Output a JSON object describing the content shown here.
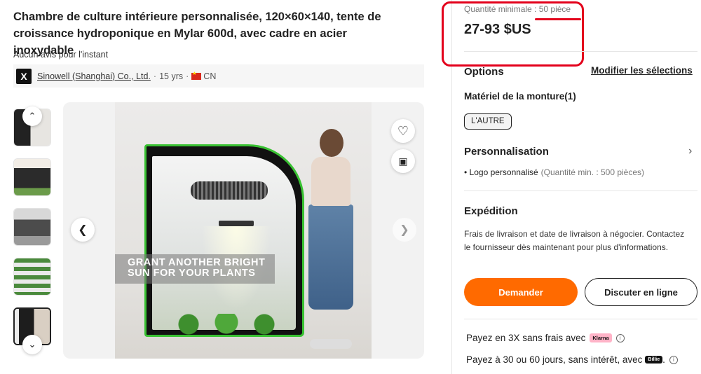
{
  "product": {
    "title": "Chambre de culture intérieure personnalisée, 120×60×140, tente de croissance hydroponique en Mylar 600d, avec cadre en acier inoxydable",
    "reviews": "Aucun avis pour l'instant"
  },
  "supplier": {
    "logo_letter": "X",
    "name": "Sinowell (Shanghai) Co., Ltd.",
    "years": "15 yrs",
    "country": "CN"
  },
  "gallery": {
    "caption_line1": "GRANT ANOTHER BRIGHT",
    "caption_line2": "SUN FOR YOUR PLANTS",
    "thumbnails": [
      "thumb-1",
      "thumb-2",
      "thumb-3",
      "thumb-4",
      "thumb-5"
    ]
  },
  "pricing": {
    "moq": "Quantité minimale : 50 pièce",
    "price": "27-93 $US"
  },
  "options": {
    "title": "Options",
    "modify_link": "Modifier les sélections",
    "material_title": "Matériel de la monture(1)",
    "material_chip": "L'AUTRE"
  },
  "customization": {
    "title": "Personnalisation",
    "item": "Logo personnalisé",
    "item_note": "(Quantité min. : 500 pièces)"
  },
  "shipping": {
    "title": "Expédition",
    "text": "Frais de livraison et date de livraison à négocier. Contactez le fournisseur dès maintenant pour plus d'informations."
  },
  "actions": {
    "request_label": "Demander",
    "chat_label": "Discuter en ligne"
  },
  "payment": {
    "line1": "Payez en 3X sans frais avec",
    "line1_badge": "Klarna",
    "line2": "Payez à 30 ou 60 jours, sans intérêt, avec",
    "line2_badge": "Billie",
    "line2_suffix": "."
  },
  "colors": {
    "accent": "#ff6a00",
    "annotation_red": "#e3001b"
  }
}
